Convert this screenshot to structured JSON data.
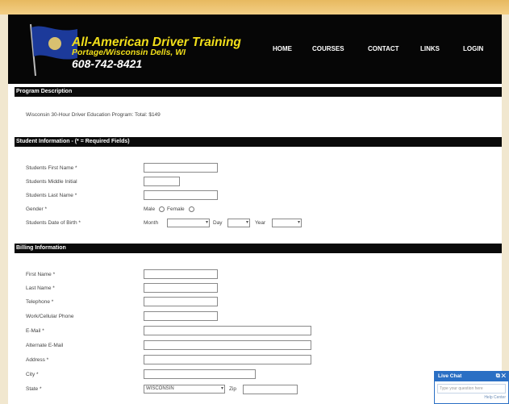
{
  "header": {
    "title": "All-American Driver Training",
    "subtitle": "Portage/Wisconsin Dells, WI",
    "phone": "608-742-8421",
    "nav": [
      "HOME",
      "COURSES",
      "CONTACT",
      "LINKS",
      "LOGIN"
    ]
  },
  "program": {
    "section_title": "Program Description",
    "description": "Wisconsin 30-Hour Driver Education Program: Total: $149"
  },
  "student": {
    "section_title": "Student Information - (* = Required Fields)",
    "labels": [
      "Students First Name *",
      "Students Middle Initial",
      "Students Last Name *",
      "Gender *",
      "Students Date of Birth *"
    ],
    "gender_male": "Male",
    "gender_female": "Female",
    "dob_month": "Month",
    "dob_day": "Day",
    "dob_year": "Year"
  },
  "billing": {
    "section_title": "Billing Information",
    "labels": [
      "First Name *",
      "Last Name *",
      "Telephone *",
      "Work/Cellular Phone",
      "E-Mail *",
      "Alternate E-Mail",
      "Address *",
      "City *",
      "State *"
    ],
    "state_value": "WISCONSIN",
    "zip_label": "Zip"
  },
  "chat": {
    "title": "Live Chat",
    "icons": [
      "popout-icon",
      "close-icon"
    ],
    "placeholder": "Type your question here",
    "footer": "Help Center"
  },
  "colors": {
    "accent_gold": "#e7b960",
    "header_bg": "#060606",
    "brand_yellow": "#f2df1a",
    "chat_blue": "#2a6fc4"
  }
}
